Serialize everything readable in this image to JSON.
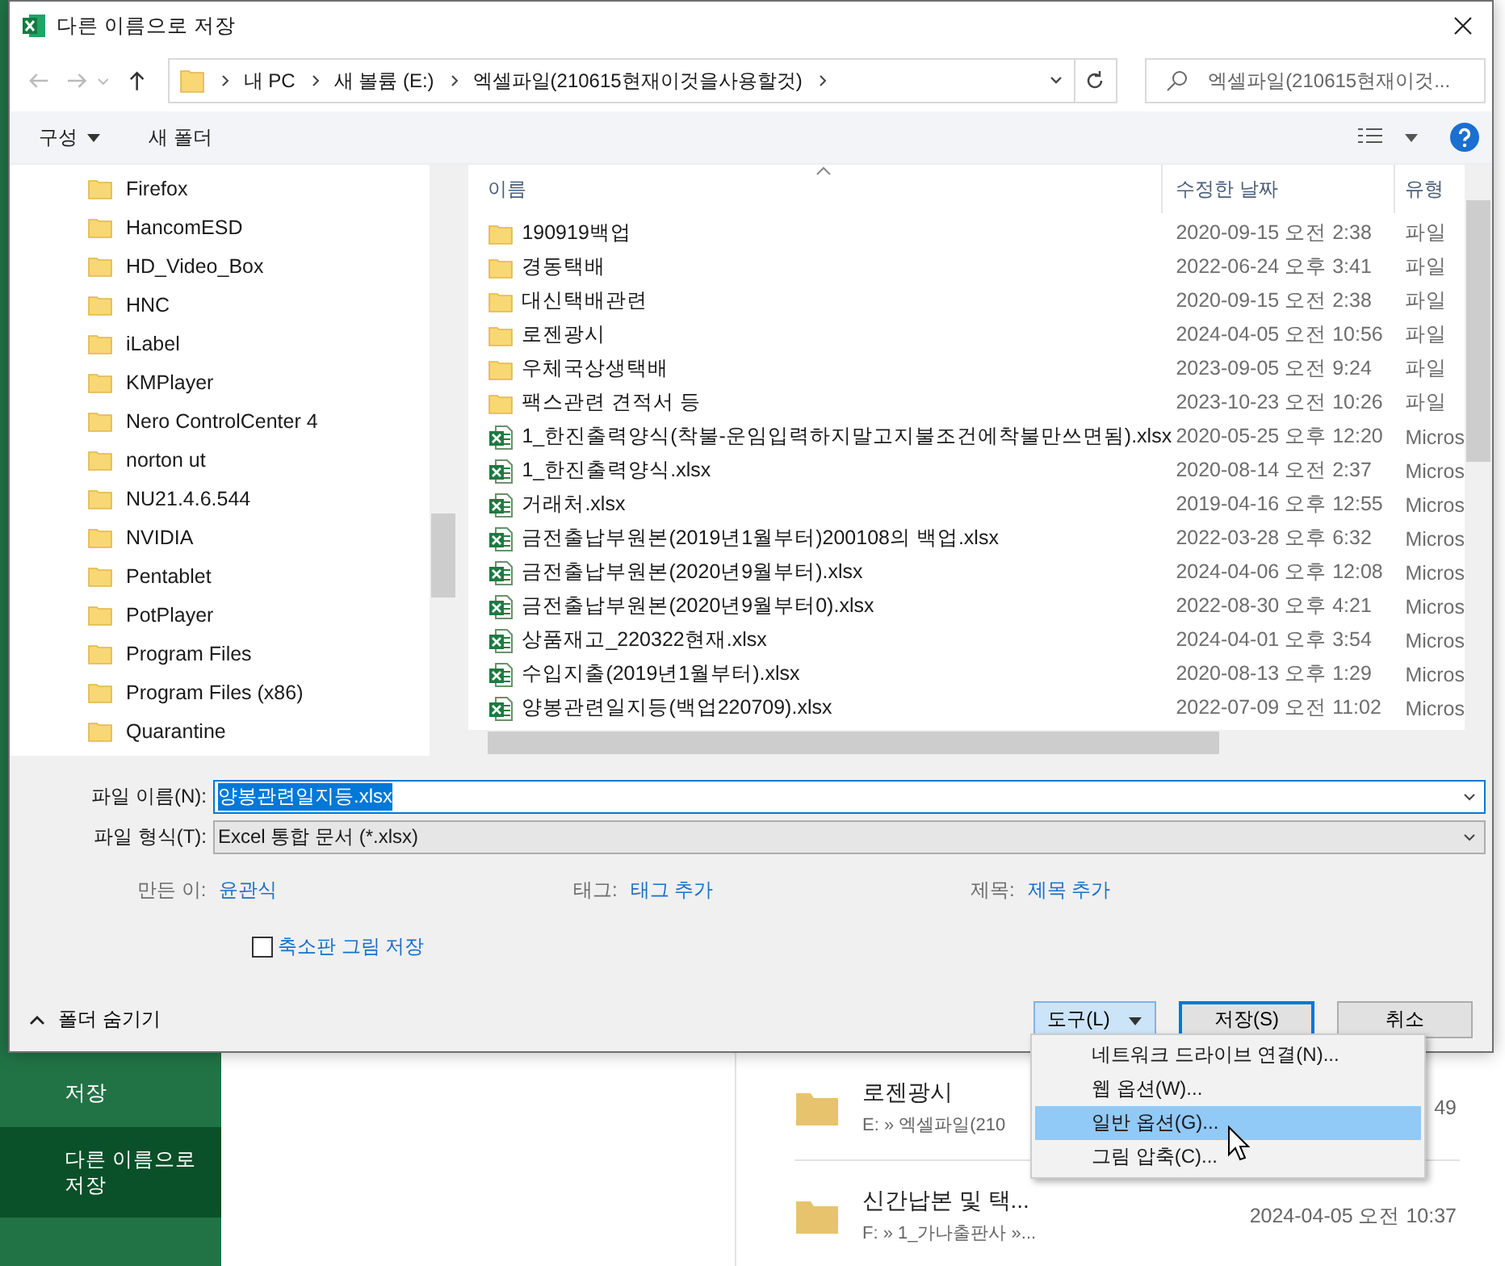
{
  "window": {
    "title": "다른 이름으로 저장"
  },
  "navigation": {
    "path": [
      {
        "label": "내 PC"
      },
      {
        "label": "새 볼륨 (E:)"
      },
      {
        "label": "엑셀파일(210615현재이것을사용할것)"
      }
    ],
    "search": {
      "placeholder": "엑셀파일(210615현재이것..."
    }
  },
  "toolbar": {
    "organize": "구성",
    "new_folder": "새 폴더"
  },
  "folder_tree": {
    "items": [
      {
        "name": "Firefox"
      },
      {
        "name": "HancomESD"
      },
      {
        "name": "HD_Video_Box"
      },
      {
        "name": "HNC"
      },
      {
        "name": "iLabel"
      },
      {
        "name": "KMPlayer"
      },
      {
        "name": "Nero ControlCenter 4"
      },
      {
        "name": "norton ut"
      },
      {
        "name": "NU21.4.6.544"
      },
      {
        "name": "NVIDIA"
      },
      {
        "name": "Pentablet"
      },
      {
        "name": "PotPlayer"
      },
      {
        "name": "Program Files"
      },
      {
        "name": "Program Files (x86)"
      },
      {
        "name": "Quarantine"
      }
    ]
  },
  "file_list": {
    "columns": [
      "이름",
      "수정한 날짜",
      "유형"
    ],
    "rows": [
      {
        "kind": "folder",
        "name": "190919백업",
        "modified": "2020-09-15 오전 2:38",
        "type": "파일"
      },
      {
        "kind": "folder",
        "name": "경동택배",
        "modified": "2022-06-24 오후 3:41",
        "type": "파일"
      },
      {
        "kind": "folder",
        "name": "대신택배관련",
        "modified": "2020-09-15 오전 2:38",
        "type": "파일"
      },
      {
        "kind": "folder",
        "name": "로젠광시",
        "modified": "2024-04-05 오전 10:56",
        "type": "파일"
      },
      {
        "kind": "folder",
        "name": "우체국상생택배",
        "modified": "2023-09-05 오전 9:24",
        "type": "파일"
      },
      {
        "kind": "folder",
        "name": "팩스관련 견적서 등",
        "modified": "2023-10-23 오전 10:26",
        "type": "파일"
      },
      {
        "kind": "excel",
        "name": "1_한진출력양식(착불-운임입력하지말고지불조건에착불만쓰면됨).xlsx",
        "modified": "2020-05-25 오후 12:20",
        "type": "Micros"
      },
      {
        "kind": "excel",
        "name": "1_한진출력양식.xlsx",
        "modified": "2020-08-14 오전 2:37",
        "type": "Micros"
      },
      {
        "kind": "excel",
        "name": "거래처.xlsx",
        "modified": "2019-04-16 오후 12:55",
        "type": "Micros"
      },
      {
        "kind": "excel",
        "name": "금전출납부원본(2019년1월부터)200108의 백업.xlsx",
        "modified": "2022-03-28 오후 6:32",
        "type": "Micros"
      },
      {
        "kind": "excel",
        "name": "금전출납부원본(2020년9월부터).xlsx",
        "modified": "2024-04-06 오후 12:08",
        "type": "Micros"
      },
      {
        "kind": "excel",
        "name": "금전출납부원본(2020년9월부터0).xlsx",
        "modified": "2022-08-30 오후 4:21",
        "type": "Micros"
      },
      {
        "kind": "excel",
        "name": "상품재고_220322현재.xlsx",
        "modified": "2024-04-01 오후 3:54",
        "type": "Micros"
      },
      {
        "kind": "excel",
        "name": "수입지출(2019년1월부터).xlsx",
        "modified": "2020-08-13 오후 1:29",
        "type": "Micros"
      },
      {
        "kind": "excel",
        "name": "양봉관련일지등(백업220709).xlsx",
        "modified": "2022-07-09 오전 11:02",
        "type": "Micros"
      }
    ]
  },
  "form": {
    "file_name": {
      "label": "파일 이름(N):",
      "value": "양봉관련일지등.xlsx"
    },
    "file_type": {
      "label": "파일 형식(T):",
      "value": "Excel 통합 문서 (*.xlsx)"
    },
    "properties": [
      {
        "label": "만든 이:",
        "value": "윤관식"
      },
      {
        "label": "태그:",
        "value": "태그 추가"
      },
      {
        "label": "제목:",
        "value": "제목 추가"
      }
    ],
    "thumbnail": {
      "label": "축소판 그림 저장",
      "checked": false
    }
  },
  "footer": {
    "hide_folders": "폴더 숨기기",
    "tools": {
      "label": "도구(L)",
      "expanded": true
    },
    "save": "저장(S)",
    "cancel": "취소"
  },
  "tools_menu": {
    "items": [
      {
        "label": "네트워크 드라이브 연결(N)...",
        "selected": false
      },
      {
        "label": "웹 옵션(W)...",
        "selected": false
      },
      {
        "label": "일반 옵션(G)...",
        "selected": true
      },
      {
        "label": "그림 압축(C)...",
        "selected": false
      }
    ]
  },
  "backstage": {
    "nav": [
      {
        "label": "저장",
        "selected": false
      },
      {
        "label": "다른 이름으로 저장",
        "selected": true
      }
    ],
    "recent": [
      {
        "name": "로젠광시",
        "path": "E: » 엑셀파일(210",
        "date": "49"
      },
      {
        "name": "신간납본 및 택...",
        "path": "F: » 1_가나출판사 »...",
        "date": "2024-04-05 오전 10:37"
      }
    ]
  }
}
